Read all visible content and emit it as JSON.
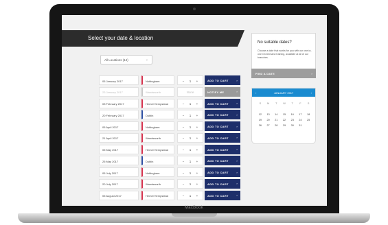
{
  "device": {
    "brand": "MacBook"
  },
  "page": {
    "title": "Select your date & location",
    "location_select": "All Locations (14)"
  },
  "sessions": [
    {
      "date": "05 January 2017",
      "location": "Nottingham",
      "qty": "1",
      "action": "ADD TO CART",
      "available": true,
      "color": "#d6324e"
    },
    {
      "date": "23 January 2017",
      "location": "Wandsworth",
      "qty": "None",
      "action": "NOTIFY ME",
      "available": false,
      "color": "#c8c8c8"
    },
    {
      "date": "03 February 2017",
      "location": "Hemel Hempstead",
      "qty": "1",
      "action": "ADD TO CART",
      "available": true,
      "color": "#d6324e"
    },
    {
      "date": "20 February 2017",
      "location": "Dublin",
      "qty": "1",
      "action": "ADD TO CART",
      "available": true,
      "color": "#2d4fa3"
    },
    {
      "date": "05 April 2017",
      "location": "Nottingham",
      "qty": "1",
      "action": "ADD TO CART",
      "available": true,
      "color": "#d6324e"
    },
    {
      "date": "21 April 2017",
      "location": "Wandsworth",
      "qty": "1",
      "action": "ADD TO CART",
      "available": true,
      "color": "#d6324e"
    },
    {
      "date": "05 May 2017",
      "location": "Hemel Hempstead",
      "qty": "1",
      "action": "ADD TO CART",
      "available": true,
      "color": "#d6324e"
    },
    {
      "date": "25 May 2017",
      "location": "Dublin",
      "qty": "1",
      "action": "ADD TO CART",
      "available": true,
      "color": "#2d4fa3"
    },
    {
      "date": "05 July 2017",
      "location": "Nottingham",
      "qty": "1",
      "action": "ADD TO CART",
      "available": true,
      "color": "#d6324e"
    },
    {
      "date": "20 July 2017",
      "location": "Wandsworth",
      "qty": "1",
      "action": "ADD TO CART",
      "available": true,
      "color": "#d6324e"
    },
    {
      "date": "05 August 2017",
      "location": "Hemel Hempstead",
      "qty": "1",
      "action": "ADD TO CART",
      "available": true,
      "color": "#d6324e"
    }
  ],
  "panel": {
    "title": "No suitable dates?",
    "text": "Choose a date that works for you with our one-to-one On Demand training, available at all of our branches.",
    "find_label": "FIND A DATE"
  },
  "calendar": {
    "month": "JANUARY 2017",
    "day_headers": [
      "S",
      "M",
      "T",
      "W",
      "T",
      "F",
      "S"
    ],
    "days": [
      "",
      "",
      "",
      "",
      "",
      "",
      "",
      "",
      "",
      "",
      "",
      "",
      "",
      "",
      "12",
      "13",
      "14",
      "15",
      "16",
      "17",
      "18",
      "19",
      "20",
      "21",
      "22",
      "23",
      "24",
      "25",
      "26",
      "27",
      "28",
      "29",
      "30",
      "31",
      "",
      "",
      "",
      "",
      "",
      "",
      "",
      ""
    ]
  },
  "icons": {
    "minus": "minus-icon",
    "plus": "plus-icon",
    "arrow": "chevron-right-icon",
    "prev": "chevron-left-icon"
  }
}
